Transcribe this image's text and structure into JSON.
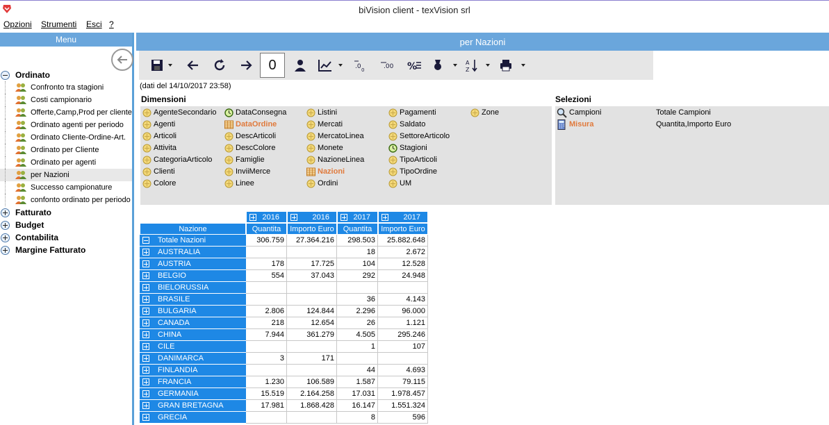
{
  "window": {
    "title": "biVision client - texVision srl"
  },
  "menubar": [
    "Opzioni",
    "Strumenti",
    "Esci",
    "?"
  ],
  "left": {
    "header": "Menu",
    "groups": [
      {
        "label": "Ordinato",
        "expanded": true,
        "items": [
          "Confronto tra stagioni",
          "Costi campionario",
          "Offerte,Camp,Prod per cliente",
          "Ordinato agenti per periodo",
          "Ordinato Cliente-Ordine-Art.",
          "Ordinato per Cliente",
          "Ordinato per agenti",
          "per Nazioni",
          "Successo campionature",
          "confonto ordinato per periodo"
        ]
      },
      {
        "label": "Fatturato",
        "expanded": false,
        "items": []
      },
      {
        "label": "Budget",
        "expanded": false,
        "items": []
      },
      {
        "label": "Contabilita",
        "expanded": false,
        "items": []
      },
      {
        "label": "Margine Fatturato",
        "expanded": false,
        "items": []
      }
    ],
    "selected_item": "per Nazioni"
  },
  "right": {
    "header": "per Nazioni",
    "toolbar": {
      "counter": "0"
    },
    "data_line": "(dati del 14/10/2017 23:58)",
    "dimensions_title": "Dimensioni",
    "dimensions": [
      {
        "label": "AgenteSecondario",
        "icon": "dimension-icon",
        "active": false
      },
      {
        "label": "Agenti",
        "icon": "dimension-icon",
        "active": false
      },
      {
        "label": "Articoli",
        "icon": "dimension-icon",
        "active": false
      },
      {
        "label": "Attivita",
        "icon": "dimension-icon",
        "active": false
      },
      {
        "label": "CategoriaArticolo",
        "icon": "dimension-icon",
        "active": false
      },
      {
        "label": "Clienti",
        "icon": "dimension-icon",
        "active": false
      },
      {
        "label": "Colore",
        "icon": "dimension-icon",
        "active": false
      },
      {
        "label": "DataConsegna",
        "icon": "clock-icon",
        "active": false
      },
      {
        "label": "DataOrdine",
        "icon": "table-icon",
        "active": true
      },
      {
        "label": "DescArticoli",
        "icon": "dimension-icon",
        "active": false
      },
      {
        "label": "DescColore",
        "icon": "dimension-icon",
        "active": false
      },
      {
        "label": "Famiglie",
        "icon": "dimension-icon",
        "active": false
      },
      {
        "label": "InviiMerce",
        "icon": "dimension-icon",
        "active": false
      },
      {
        "label": "Linee",
        "icon": "dimension-icon",
        "active": false
      },
      {
        "label": "Listini",
        "icon": "dimension-icon",
        "active": false
      },
      {
        "label": "Mercati",
        "icon": "dimension-icon",
        "active": false
      },
      {
        "label": "MercatoLinea",
        "icon": "dimension-icon",
        "active": false
      },
      {
        "label": "Monete",
        "icon": "dimension-icon",
        "active": false
      },
      {
        "label": "NazioneLinea",
        "icon": "dimension-icon",
        "active": false
      },
      {
        "label": "Nazioni",
        "icon": "table-icon",
        "active": true
      },
      {
        "label": "Ordini",
        "icon": "dimension-icon",
        "active": false
      },
      {
        "label": "Pagamenti",
        "icon": "dimension-icon",
        "active": false
      },
      {
        "label": "Saldato",
        "icon": "dimension-icon",
        "active": false
      },
      {
        "label": "SettoreArticolo",
        "icon": "dimension-icon",
        "active": false
      },
      {
        "label": "Stagioni",
        "icon": "clock-icon",
        "active": false
      },
      {
        "label": "TipoArticoli",
        "icon": "dimension-icon",
        "active": false
      },
      {
        "label": "TipoOrdine",
        "icon": "dimension-icon",
        "active": false
      },
      {
        "label": "UM",
        "icon": "dimension-icon",
        "active": false
      },
      {
        "label": "Zone",
        "icon": "dimension-icon",
        "active": false
      }
    ],
    "selections_title": "Selezioni",
    "selections": [
      {
        "key": "Campioni",
        "value": "Totale Campioni",
        "icon": "magnifier-icon",
        "active": false
      },
      {
        "key": "Misura",
        "value": "Quantita,Importo Euro",
        "icon": "calculator-icon",
        "active": true
      }
    ],
    "pivot": {
      "row_header": "Nazione",
      "years": [
        "2016",
        "2016",
        "2017",
        "2017"
      ],
      "measures": [
        "Quantita",
        "Importo Euro",
        "Quantita",
        "Importo Euro"
      ],
      "rows": [
        {
          "label": "Totale Nazioni",
          "expanded": true,
          "values": [
            "306.759",
            "27.364.216",
            "298.503",
            "25.882.648"
          ]
        },
        {
          "label": "AUSTRALIA",
          "expanded": false,
          "values": [
            "",
            "",
            "18",
            "2.672"
          ]
        },
        {
          "label": "AUSTRIA",
          "expanded": false,
          "values": [
            "178",
            "17.725",
            "104",
            "12.528"
          ]
        },
        {
          "label": "BELGIO",
          "expanded": false,
          "values": [
            "554",
            "37.043",
            "292",
            "24.948"
          ]
        },
        {
          "label": "BIELORUSSIA",
          "expanded": false,
          "values": [
            "",
            "",
            "",
            ""
          ]
        },
        {
          "label": "BRASILE",
          "expanded": false,
          "values": [
            "",
            "",
            "36",
            "4.143"
          ]
        },
        {
          "label": "BULGARIA",
          "expanded": false,
          "values": [
            "2.806",
            "124.844",
            "2.296",
            "96.000"
          ]
        },
        {
          "label": "CANADA",
          "expanded": false,
          "values": [
            "218",
            "12.654",
            "26",
            "1.121"
          ]
        },
        {
          "label": "CHINA",
          "expanded": false,
          "values": [
            "7.944",
            "361.279",
            "4.505",
            "295.246"
          ]
        },
        {
          "label": "CILE",
          "expanded": false,
          "values": [
            "",
            "",
            "1",
            "107"
          ]
        },
        {
          "label": "DANIMARCA",
          "expanded": false,
          "values": [
            "3",
            "171",
            "",
            ""
          ]
        },
        {
          "label": "FINLANDIA",
          "expanded": false,
          "values": [
            "",
            "",
            "44",
            "4.693"
          ]
        },
        {
          "label": "FRANCIA",
          "expanded": false,
          "values": [
            "1.230",
            "106.589",
            "1.587",
            "79.115"
          ]
        },
        {
          "label": "GERMANIA",
          "expanded": false,
          "values": [
            "15.519",
            "2.164.258",
            "17.031",
            "1.978.457"
          ]
        },
        {
          "label": "GRAN BRETAGNA",
          "expanded": false,
          "values": [
            "17.981",
            "1.868.428",
            "16.147",
            "1.551.324"
          ]
        },
        {
          "label": "GRECIA",
          "expanded": false,
          "values": [
            "",
            "",
            "8",
            "596"
          ]
        }
      ]
    }
  },
  "colors": {
    "accent": "#1e88e5",
    "panel_header": "#6aa6dc",
    "active_dimension": "#e07a3c"
  }
}
